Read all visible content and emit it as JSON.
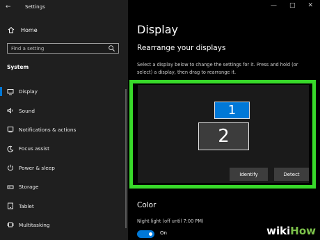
{
  "window": {
    "title": "Settings",
    "back_icon": "back-arrow-icon",
    "controls": [
      "minimize-icon",
      "maximize-icon",
      "close-icon"
    ]
  },
  "sidebar": {
    "home_label": "Home",
    "search_placeholder": "Find a setting",
    "section_label": "System",
    "items": [
      {
        "label": "Display",
        "icon": "monitor-icon",
        "active": true
      },
      {
        "label": "Sound",
        "icon": "speaker-icon",
        "active": false
      },
      {
        "label": "Notifications & actions",
        "icon": "notification-icon",
        "active": false
      },
      {
        "label": "Focus assist",
        "icon": "moon-icon",
        "active": false
      },
      {
        "label": "Power & sleep",
        "icon": "power-icon",
        "active": false
      },
      {
        "label": "Storage",
        "icon": "storage-icon",
        "active": false
      },
      {
        "label": "Tablet",
        "icon": "tablet-icon",
        "active": false
      },
      {
        "label": "Multitasking",
        "icon": "multitasking-icon",
        "active": false
      }
    ]
  },
  "main": {
    "title": "Display",
    "subtitle": "Rearrange your displays",
    "description": "Select a display below to change the settings for it. Press and hold (or select) a display, then drag to rearrange it.",
    "monitors": [
      "1",
      "2"
    ],
    "identify_label": "Identify",
    "detect_label": "Detect",
    "color_heading": "Color",
    "night_light_label": "Night light (off until 7:00 PM)",
    "toggle_label": "On",
    "toggle_on": true
  },
  "watermark": {
    "part1": "wiki",
    "part2": "How"
  },
  "colors": {
    "accent": "#0078d7",
    "highlight": "#38d92a",
    "sidebar_bg": "#1f1f1f",
    "main_bg": "#000000"
  }
}
